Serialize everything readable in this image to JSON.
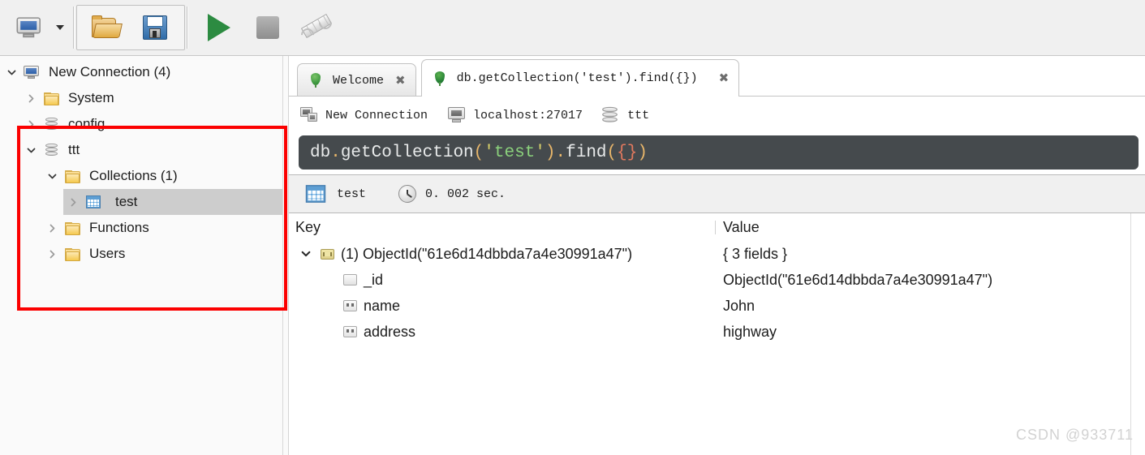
{
  "toolbar": {
    "buttons": [
      {
        "name": "connect-button",
        "icon": "computers-icon",
        "label": "Connect"
      },
      {
        "name": "connect-dropdown",
        "icon": "chevron-down-icon",
        "label": ""
      },
      {
        "name": "open-script-button",
        "icon": "folder-open-icon",
        "label": "Open Script"
      },
      {
        "name": "save-script-button",
        "icon": "floppy-save-icon",
        "label": "Save Script"
      },
      {
        "name": "execute-button",
        "icon": "play-icon",
        "label": "Execute"
      },
      {
        "name": "stop-button",
        "icon": "stop-icon",
        "label": "Stop"
      },
      {
        "name": "explain-button",
        "icon": "explain-ruler-icon",
        "label": "Explain"
      }
    ]
  },
  "tree": {
    "items": [
      {
        "label": "New Connection (4)",
        "icon": "server-icon",
        "indent": 0,
        "twisty": "expanded",
        "selected": false
      },
      {
        "label": "System",
        "icon": "folder-icon",
        "indent": 1,
        "twisty": "collapsed",
        "selected": false
      },
      {
        "label": "config",
        "icon": "database-icon",
        "indent": 1,
        "twisty": "collapsed",
        "selected": false
      },
      {
        "label": "ttt",
        "icon": "database-icon",
        "indent": 1,
        "twisty": "expanded",
        "selected": false
      },
      {
        "label": "Collections (1)",
        "icon": "folder-icon",
        "indent": 2,
        "twisty": "expanded",
        "selected": false
      },
      {
        "label": "test",
        "icon": "collection-icon",
        "indent": 3,
        "twisty": "collapsed",
        "selected": true
      },
      {
        "label": "Functions",
        "icon": "folder-icon",
        "indent": 2,
        "twisty": "collapsed",
        "selected": false
      },
      {
        "label": "Users",
        "icon": "folder-icon",
        "indent": 2,
        "twisty": "collapsed",
        "selected": false
      }
    ]
  },
  "annotation": {
    "color": "#fb0000",
    "shape": "rectangle"
  },
  "tabs": [
    {
      "label": "Welcome",
      "icon": "leaf-icon",
      "close": "✖",
      "active": false
    },
    {
      "label": "db.getCollection('test').find({})",
      "icon": "leaf-icon",
      "close": "✖",
      "active": true
    }
  ],
  "breadcrumb": [
    {
      "label": "New Connection",
      "icon": "connection-icon"
    },
    {
      "label": "localhost:27017",
      "icon": "host-icon"
    },
    {
      "label": "ttt",
      "icon": "database-icon"
    }
  ],
  "query": {
    "full_text": "db.getCollection('test').find({})",
    "tokens": [
      {
        "t": "db",
        "c": "q-id"
      },
      {
        "t": ".",
        "c": "q-dot"
      },
      {
        "t": "getCollection",
        "c": "q-id"
      },
      {
        "t": "(",
        "c": "q-paren"
      },
      {
        "t": "'",
        "c": "q-quote"
      },
      {
        "t": "test",
        "c": "q-str"
      },
      {
        "t": "'",
        "c": "q-quote"
      },
      {
        "t": ")",
        "c": "q-paren"
      },
      {
        "t": ".",
        "c": "q-dot"
      },
      {
        "t": "find",
        "c": "q-id"
      },
      {
        "t": "(",
        "c": "q-paren"
      },
      {
        "t": "{",
        "c": "q-brace"
      },
      {
        "t": "}",
        "c": "q-brace"
      },
      {
        "t": ")",
        "c": "q-paren"
      }
    ],
    "bg_color": "#454a4d"
  },
  "result_toolbar": {
    "collection": "test",
    "collection_icon": "collection-icon",
    "time_icon": "clock-icon",
    "elapsed": "0. 002 sec."
  },
  "grid": {
    "headers": {
      "key": "Key",
      "value": "Value"
    },
    "rows": [
      {
        "twisty": "expanded",
        "icon": "document-icon",
        "indent": 0,
        "key": "(1) ObjectId(\"61e6d14dbbda7a4e30991a47\")",
        "value": "{ 3 fields }"
      },
      {
        "twisty": "none",
        "icon": "blank-field-icon",
        "indent": 1,
        "key": "_id",
        "value": "ObjectId(\"61e6d14dbbda7a4e30991a47\")"
      },
      {
        "twisty": "none",
        "icon": "string-field-icon",
        "indent": 1,
        "key": "name",
        "value": "John"
      },
      {
        "twisty": "none",
        "icon": "string-field-icon",
        "indent": 1,
        "key": "address",
        "value": "highway"
      }
    ]
  },
  "watermark": "CSDN @933711"
}
